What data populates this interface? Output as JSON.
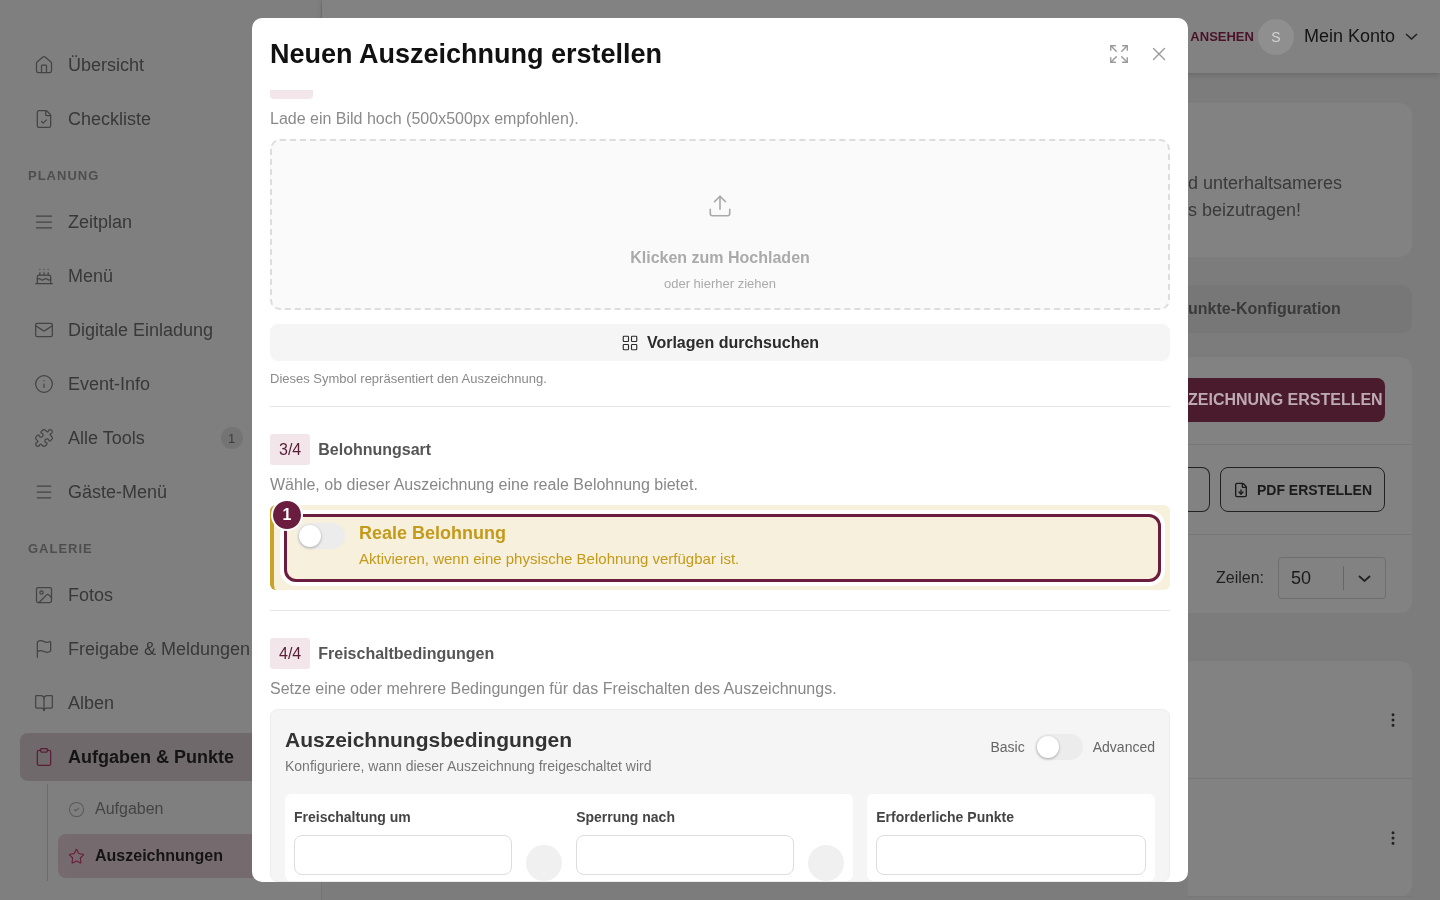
{
  "sidebar": {
    "sections": [
      {
        "items": [
          {
            "label": "Übersicht",
            "selected": false
          },
          {
            "label": "Checkliste",
            "selected": false
          }
        ]
      },
      {
        "heading": "PLANUNG",
        "items": [
          {
            "label": "Zeitplan",
            "selected": false
          },
          {
            "label": "Menü",
            "selected": false
          },
          {
            "label": "Digitale Einladung",
            "selected": false
          },
          {
            "label": "Event-Info",
            "selected": false
          },
          {
            "label": "Alle Tools",
            "selected": false,
            "badge": "1"
          },
          {
            "label": "Gäste-Menü",
            "selected": false
          }
        ]
      },
      {
        "heading": "GALERIE",
        "items": [
          {
            "label": "Fotos",
            "selected": false
          },
          {
            "label": "Freigabe & Meldungen",
            "selected": false
          },
          {
            "label": "Alben",
            "selected": false
          },
          {
            "label": "Aufgaben & Punkte",
            "selected": true,
            "children": [
              {
                "label": "Aufgaben",
                "selected": false
              },
              {
                "label": "Auszeichnungen",
                "selected": true
              }
            ]
          }
        ]
      }
    ]
  },
  "header": {
    "link": "ANSEHEN",
    "account": {
      "avatar": "S",
      "label": "Mein Konto"
    }
  },
  "background": {
    "intro_lines": [
      "d unterhaltsameres",
      "s beizutragen!"
    ],
    "config_bar": "unkte-Konfiguration",
    "create_button": "ZEICHNUNG ERSTELLEN",
    "pdf_button": "PDF ERSTELLEN",
    "rows_label": "Zeilen:",
    "rows_value": "50",
    "list_rows": [
      {
        "kind": "entry"
      },
      {
        "kind": "entry"
      }
    ]
  },
  "modal": {
    "title": "Neuen Auszeichnung erstellen",
    "upload_hint": "Lade ein Bild hoch (500x500px empfohlen).",
    "upload": {
      "title": "Klicken zum Hochladen",
      "subtitle": "oder hierher ziehen"
    },
    "templates_button": "Vorlagen durchsuchen",
    "symbol_hint": "Dieses Symbol repräsentiert den Auszeichnung.",
    "steps": [
      {
        "badge": "3/4",
        "title": "Belohnungsart",
        "description": "Wähle, ob dieser Auszeichnung eine reale Belohnung bietet."
      },
      {
        "badge": "4/4",
        "title": "Freischaltbedingungen",
        "description": "Setze eine oder mehrere Bedingungen für das Freischalten des Auszeichnungs."
      }
    ],
    "reward_toggle": {
      "tour_badge": "1",
      "title": "Reale Belohnung",
      "description": "Aktivieren, wenn eine physische Belohnung verfügbar ist.",
      "on": false
    },
    "conditions": {
      "title": "Auszeichnungsbedingungen",
      "subtitle": "Konfiguriere, wann dieser Auszeichnung freigeschaltet wird",
      "mode_left": "Basic",
      "mode_right": "Advanced",
      "advanced": false,
      "fields": [
        {
          "label": "Freischaltung um"
        },
        {
          "label": "Sperrung nach"
        },
        {
          "label": "Erforderliche Punkte"
        }
      ]
    }
  }
}
